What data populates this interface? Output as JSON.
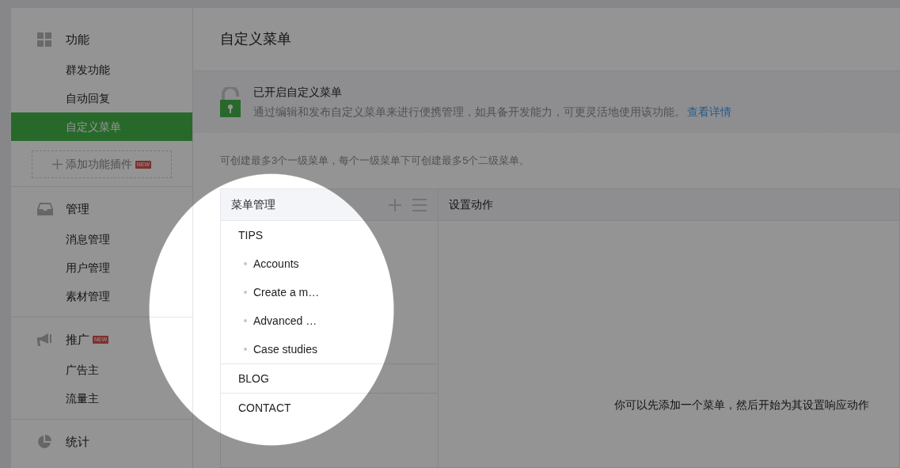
{
  "sidebar": {
    "sections": [
      {
        "kind": "grid",
        "title": "功能",
        "items": [
          {
            "label": "群发功能",
            "selected": false
          },
          {
            "label": "自动回复",
            "selected": false
          },
          {
            "label": "自定义菜单",
            "selected": true
          }
        ],
        "add_button": {
          "label": "添加功能插件",
          "badge": "NEW"
        }
      },
      {
        "kind": "inbox",
        "title": "管理",
        "items": [
          {
            "label": "消息管理",
            "selected": false
          },
          {
            "label": "用户管理",
            "selected": false
          },
          {
            "label": "素材管理",
            "selected": false
          }
        ]
      },
      {
        "kind": "megaphone",
        "title": "推广",
        "badge": "NEW",
        "items": [
          {
            "label": "广告主",
            "selected": false
          },
          {
            "label": "流量主",
            "selected": false
          }
        ]
      },
      {
        "kind": "pie",
        "title": "统计"
      }
    ]
  },
  "page_title": "自定义菜单",
  "notice": {
    "title": "已开启自定义菜单",
    "text": "通过编辑和发布自定义菜单来进行便携管理，如具备开发能力，可更灵活地使用该功能。",
    "link": "查看详情"
  },
  "hint": "可创建最多3个一级菜单，每个一级菜单下可创建最多5个二级菜单。",
  "menu_panel": {
    "title": "菜单管理",
    "items": [
      {
        "label": "TIPS",
        "children": [
          {
            "label": "Accounts"
          },
          {
            "label": "Create a m…"
          },
          {
            "label": "Advanced …"
          },
          {
            "label": "Case studies"
          }
        ]
      },
      {
        "label": "BLOG"
      },
      {
        "label": "CONTACT"
      }
    ]
  },
  "action_panel": {
    "title": "设置动作",
    "empty_text": "你可以先添加一个菜单，然后开始为其设置响应动作"
  }
}
